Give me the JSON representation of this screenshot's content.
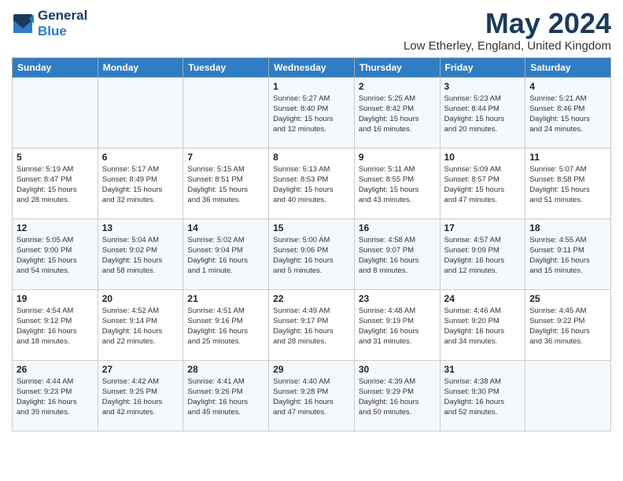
{
  "header": {
    "logo_general": "General",
    "logo_blue": "Blue",
    "month": "May 2024",
    "location": "Low Etherley, England, United Kingdom"
  },
  "days_of_week": [
    "Sunday",
    "Monday",
    "Tuesday",
    "Wednesday",
    "Thursday",
    "Friday",
    "Saturday"
  ],
  "weeks": [
    [
      {
        "day": "",
        "info": ""
      },
      {
        "day": "",
        "info": ""
      },
      {
        "day": "",
        "info": ""
      },
      {
        "day": "1",
        "info": "Sunrise: 5:27 AM\nSunset: 8:40 PM\nDaylight: 15 hours\nand 12 minutes."
      },
      {
        "day": "2",
        "info": "Sunrise: 5:25 AM\nSunset: 8:42 PM\nDaylight: 15 hours\nand 16 minutes."
      },
      {
        "day": "3",
        "info": "Sunrise: 5:23 AM\nSunset: 8:44 PM\nDaylight: 15 hours\nand 20 minutes."
      },
      {
        "day": "4",
        "info": "Sunrise: 5:21 AM\nSunset: 8:46 PM\nDaylight: 15 hours\nand 24 minutes."
      }
    ],
    [
      {
        "day": "5",
        "info": "Sunrise: 5:19 AM\nSunset: 8:47 PM\nDaylight: 15 hours\nand 28 minutes."
      },
      {
        "day": "6",
        "info": "Sunrise: 5:17 AM\nSunset: 8:49 PM\nDaylight: 15 hours\nand 32 minutes."
      },
      {
        "day": "7",
        "info": "Sunrise: 5:15 AM\nSunset: 8:51 PM\nDaylight: 15 hours\nand 36 minutes."
      },
      {
        "day": "8",
        "info": "Sunrise: 5:13 AM\nSunset: 8:53 PM\nDaylight: 15 hours\nand 40 minutes."
      },
      {
        "day": "9",
        "info": "Sunrise: 5:11 AM\nSunset: 8:55 PM\nDaylight: 15 hours\nand 43 minutes."
      },
      {
        "day": "10",
        "info": "Sunrise: 5:09 AM\nSunset: 8:57 PM\nDaylight: 15 hours\nand 47 minutes."
      },
      {
        "day": "11",
        "info": "Sunrise: 5:07 AM\nSunset: 8:58 PM\nDaylight: 15 hours\nand 51 minutes."
      }
    ],
    [
      {
        "day": "12",
        "info": "Sunrise: 5:05 AM\nSunset: 9:00 PM\nDaylight: 15 hours\nand 54 minutes."
      },
      {
        "day": "13",
        "info": "Sunrise: 5:04 AM\nSunset: 9:02 PM\nDaylight: 15 hours\nand 58 minutes."
      },
      {
        "day": "14",
        "info": "Sunrise: 5:02 AM\nSunset: 9:04 PM\nDaylight: 16 hours\nand 1 minute."
      },
      {
        "day": "15",
        "info": "Sunrise: 5:00 AM\nSunset: 9:06 PM\nDaylight: 16 hours\nand 5 minutes."
      },
      {
        "day": "16",
        "info": "Sunrise: 4:58 AM\nSunset: 9:07 PM\nDaylight: 16 hours\nand 8 minutes."
      },
      {
        "day": "17",
        "info": "Sunrise: 4:57 AM\nSunset: 9:09 PM\nDaylight: 16 hours\nand 12 minutes."
      },
      {
        "day": "18",
        "info": "Sunrise: 4:55 AM\nSunset: 9:11 PM\nDaylight: 16 hours\nand 15 minutes."
      }
    ],
    [
      {
        "day": "19",
        "info": "Sunrise: 4:54 AM\nSunset: 9:12 PM\nDaylight: 16 hours\nand 18 minutes."
      },
      {
        "day": "20",
        "info": "Sunrise: 4:52 AM\nSunset: 9:14 PM\nDaylight: 16 hours\nand 22 minutes."
      },
      {
        "day": "21",
        "info": "Sunrise: 4:51 AM\nSunset: 9:16 PM\nDaylight: 16 hours\nand 25 minutes."
      },
      {
        "day": "22",
        "info": "Sunrise: 4:49 AM\nSunset: 9:17 PM\nDaylight: 16 hours\nand 28 minutes."
      },
      {
        "day": "23",
        "info": "Sunrise: 4:48 AM\nSunset: 9:19 PM\nDaylight: 16 hours\nand 31 minutes."
      },
      {
        "day": "24",
        "info": "Sunrise: 4:46 AM\nSunset: 9:20 PM\nDaylight: 16 hours\nand 34 minutes."
      },
      {
        "day": "25",
        "info": "Sunrise: 4:45 AM\nSunset: 9:22 PM\nDaylight: 16 hours\nand 36 minutes."
      }
    ],
    [
      {
        "day": "26",
        "info": "Sunrise: 4:44 AM\nSunset: 9:23 PM\nDaylight: 16 hours\nand 39 minutes."
      },
      {
        "day": "27",
        "info": "Sunrise: 4:42 AM\nSunset: 9:25 PM\nDaylight: 16 hours\nand 42 minutes."
      },
      {
        "day": "28",
        "info": "Sunrise: 4:41 AM\nSunset: 9:26 PM\nDaylight: 16 hours\nand 45 minutes."
      },
      {
        "day": "29",
        "info": "Sunrise: 4:40 AM\nSunset: 9:28 PM\nDaylight: 16 hours\nand 47 minutes."
      },
      {
        "day": "30",
        "info": "Sunrise: 4:39 AM\nSunset: 9:29 PM\nDaylight: 16 hours\nand 50 minutes."
      },
      {
        "day": "31",
        "info": "Sunrise: 4:38 AM\nSunset: 9:30 PM\nDaylight: 16 hours\nand 52 minutes."
      },
      {
        "day": "",
        "info": ""
      }
    ]
  ]
}
